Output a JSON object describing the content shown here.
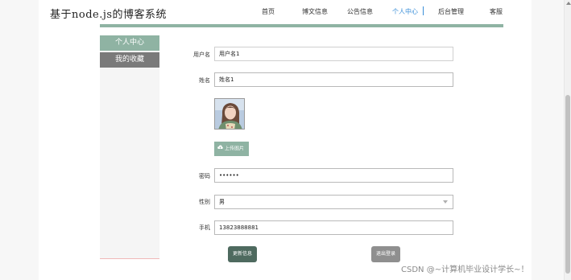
{
  "site": {
    "title": "基于node.js的博客系统"
  },
  "nav": {
    "items": [
      {
        "label": "首页"
      },
      {
        "label": "博文信息"
      },
      {
        "label": "公告信息"
      },
      {
        "label": "个人中心"
      },
      {
        "label": "后台管理"
      },
      {
        "label": "客服"
      }
    ],
    "active": "个人中心",
    "accent_color": "#3a8fd8"
  },
  "sidebar": {
    "items": [
      {
        "label": "个人中心"
      },
      {
        "label": "我的收藏"
      }
    ],
    "active_color": "#8fb3a3"
  },
  "form": {
    "username": {
      "label": "用户名",
      "value": "用户名1"
    },
    "name": {
      "label": "姓名",
      "value": "姓名1"
    },
    "upload": {
      "label": "上传图片",
      "icon": "cloud-upload-icon"
    },
    "password": {
      "label": "密码",
      "value": "••••••"
    },
    "gender": {
      "label": "性别",
      "value": "男"
    },
    "phone": {
      "label": "手机",
      "value": "13823888881"
    }
  },
  "actions": {
    "update_label": "更新信息",
    "logout_label": "退出登录"
  },
  "watermark": "CSDN @~计算机毕业设计学长~！"
}
